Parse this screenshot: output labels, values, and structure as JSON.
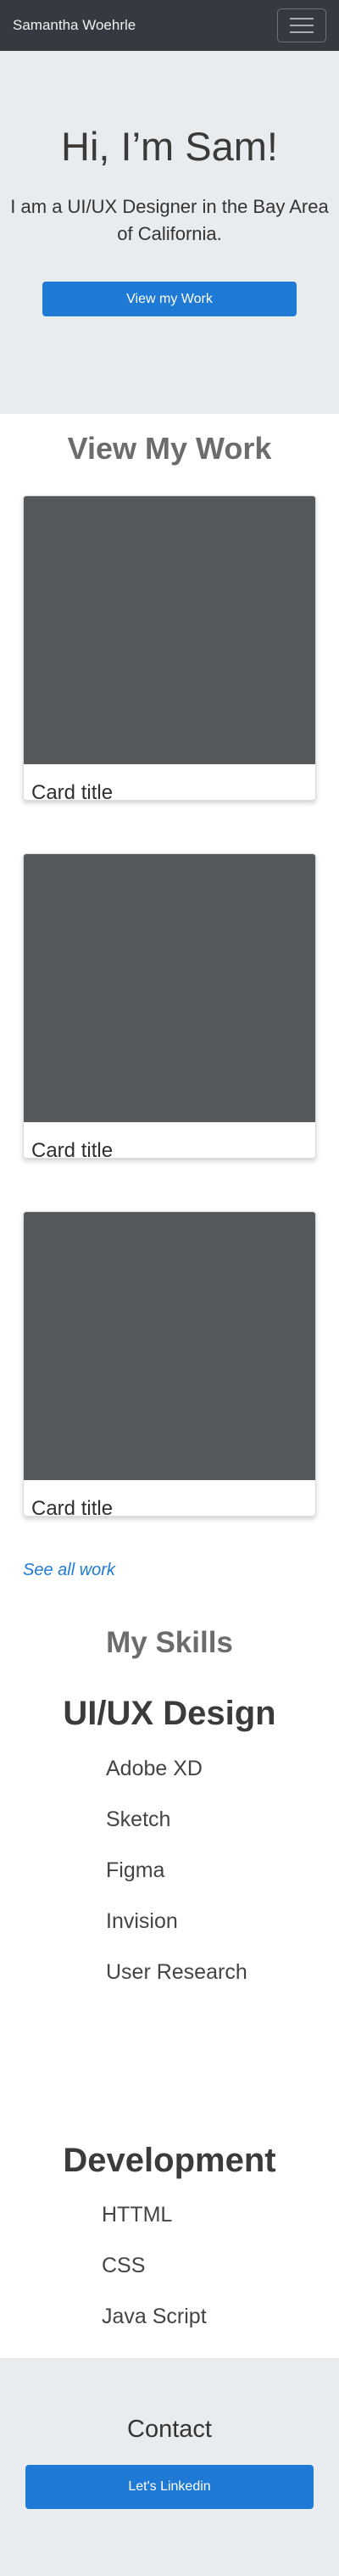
{
  "nav": {
    "brand": "Samantha Woehrle",
    "menu_icon": "hamburger-menu-icon"
  },
  "hero": {
    "title": "Hi, I’m Sam!",
    "subtitle": "I am a UI/UX Designer in the Bay Area of California.",
    "button_label": "View my Work"
  },
  "work": {
    "title": "View My Work",
    "cards": [
      {
        "title": "Card title"
      },
      {
        "title": "Card title"
      },
      {
        "title": "Card title"
      }
    ],
    "see_all_label": "See all work"
  },
  "skills": {
    "title": "My Skills",
    "design": {
      "heading": "UI/UX Design",
      "items": [
        "Adobe XD",
        "Sketch",
        "Figma",
        "Invision",
        "User Research"
      ]
    },
    "development": {
      "heading": "Development",
      "items": [
        "HTTML",
        "CSS",
        "Java Script"
      ]
    }
  },
  "contact": {
    "title": "Contact",
    "button_label": "Let's Linkedin"
  },
  "colors": {
    "navbar": "#343a40",
    "hero_bg": "#e9ecef",
    "primary": "#1f7ad6",
    "card_image": "#55595c"
  }
}
